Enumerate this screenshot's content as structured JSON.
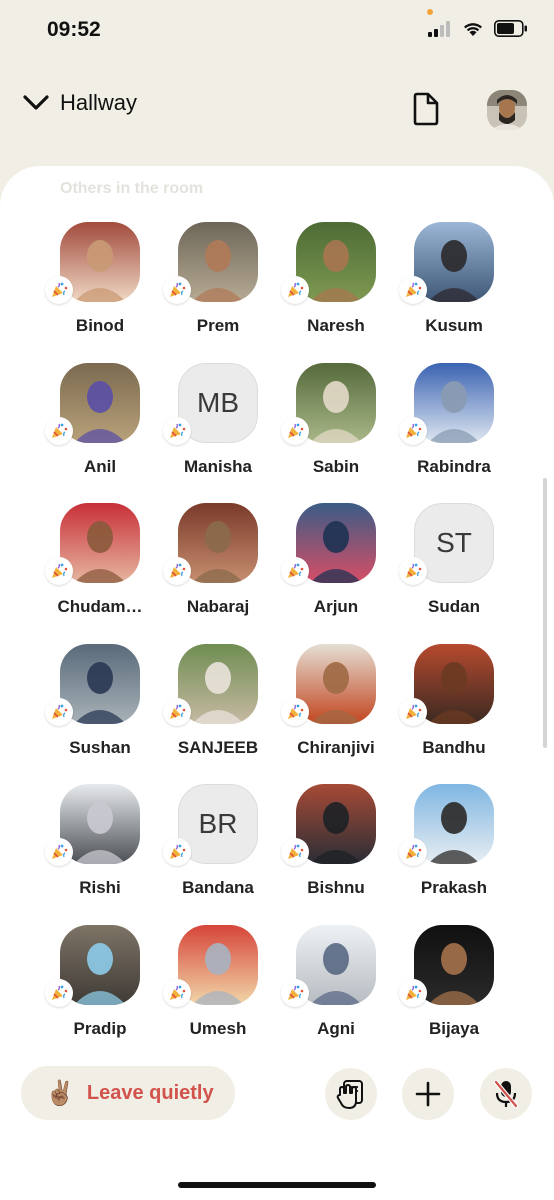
{
  "status": {
    "time": "09:52",
    "icons": [
      "cellular-signal-icon",
      "wifi-icon",
      "battery-icon"
    ]
  },
  "header": {
    "room_name": "Hallway",
    "icons": [
      "chevron-down-icon",
      "document-icon",
      "profile-avatar"
    ]
  },
  "section": {
    "label": "Others in the room"
  },
  "participants": [
    {
      "name": "Binod",
      "initials": "",
      "color_a": "#a24b3d",
      "color_b": "#f0d8c4",
      "skin": "#c99a74"
    },
    {
      "name": "Prem",
      "initials": "",
      "color_a": "#6d6658",
      "color_b": "#b7ab94",
      "skin": "#b07a58"
    },
    {
      "name": "Naresh",
      "initials": "",
      "color_a": "#4d6b35",
      "color_b": "#7f9a52",
      "skin": "#a7764f"
    },
    {
      "name": "Kusum",
      "initials": "",
      "color_a": "#9bb6d6",
      "color_b": "#3e5776",
      "skin": "#2d2a2f"
    },
    {
      "name": "Anil",
      "initials": "",
      "color_a": "#7b6a50",
      "color_b": "#b9a27a",
      "skin": "#5b4fa6"
    },
    {
      "name": "Manisha",
      "initials": "MB",
      "color_a": "",
      "color_b": "",
      "skin": ""
    },
    {
      "name": "Sabin",
      "initials": "",
      "color_a": "#566a3b",
      "color_b": "#a9b889",
      "skin": "#e2d8c6"
    },
    {
      "name": "Rabindra",
      "initials": "",
      "color_a": "#3b63b2",
      "color_b": "#dfe7f1",
      "skin": "#8a9bb2"
    },
    {
      "name": "Chudam…",
      "initials": "",
      "color_a": "#c82f38",
      "color_b": "#e6b6a0",
      "skin": "#8b5a3c"
    },
    {
      "name": "Nabaraj",
      "initials": "",
      "color_a": "#7a3a2a",
      "color_b": "#c78f70",
      "skin": "#8a6a4b"
    },
    {
      "name": "Arjun",
      "initials": "",
      "color_a": "#3a5c86",
      "color_b": "#d84e66",
      "skin": "#1f3354"
    },
    {
      "name": "Sudan",
      "initials": "ST",
      "color_a": "",
      "color_b": "",
      "skin": ""
    },
    {
      "name": "Sushan",
      "initials": "",
      "color_a": "#5a6a7a",
      "color_b": "#a8b2b8",
      "skin": "#2b3a55"
    },
    {
      "name": "SANJEEB",
      "initials": "",
      "color_a": "#6f8d52",
      "color_b": "#c7b9a3",
      "skin": "#e8e2d9"
    },
    {
      "name": "Chiranjivi",
      "initials": "",
      "color_a": "#e5ded4",
      "color_b": "#c2451e",
      "skin": "#a06a44"
    },
    {
      "name": "Bandhu",
      "initials": "",
      "color_a": "#b64a2e",
      "color_b": "#3a2a22",
      "skin": "#6b3a22"
    },
    {
      "name": "Rishi",
      "initials": "",
      "color_a": "#e8ebee",
      "color_b": "#4b4f54",
      "skin": "#c8cad0"
    },
    {
      "name": "Bandana",
      "initials": "BR",
      "color_a": "",
      "color_b": "",
      "skin": ""
    },
    {
      "name": "Bishnu",
      "initials": "",
      "color_a": "#a74a36",
      "color_b": "#2a2e36",
      "skin": "#1e2226"
    },
    {
      "name": "Prakash",
      "initials": "",
      "color_a": "#7fb6e2",
      "color_b": "#e8eef2",
      "skin": "#2d2b2a"
    },
    {
      "name": "Pradip",
      "initials": "",
      "color_a": "#7e7466",
      "color_b": "#3f3a36",
      "skin": "#8cc9e6"
    },
    {
      "name": "Umesh",
      "initials": "",
      "color_a": "#d6453a",
      "color_b": "#f1d7a8",
      "skin": "#a8b2c0"
    },
    {
      "name": "Agni",
      "initials": "",
      "color_a": "#eef1f4",
      "color_b": "#b7bcc2",
      "skin": "#5b6a86"
    },
    {
      "name": "Bijaya",
      "initials": "",
      "color_a": "#101010",
      "color_b": "#2a2a2a",
      "skin": "#a2704a"
    }
  ],
  "actions": {
    "leave_label": "Leave quietly",
    "leave_emoji": "✌🏽",
    "buttons": [
      "raise-hand-icon",
      "plus-icon",
      "microphone-muted-icon"
    ]
  },
  "colors": {
    "background": "#f1efe5",
    "sheet": "#ffffff",
    "leave_text": "#d2524c",
    "mute_red": "#d2524c"
  }
}
